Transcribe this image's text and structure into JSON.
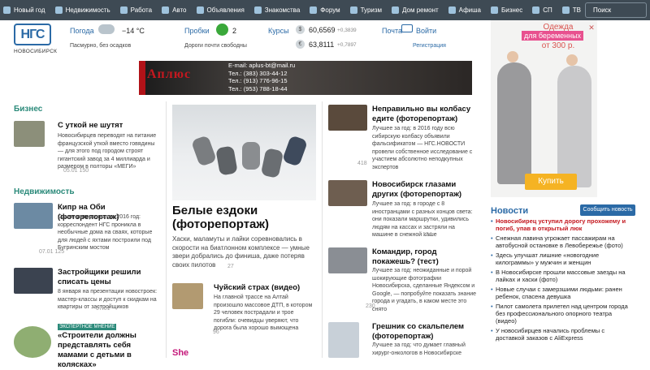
{
  "nav": {
    "items": [
      {
        "label": "Новый год",
        "icon": "snowflake-icon"
      },
      {
        "label": "Недвижимость",
        "icon": "house-icon"
      },
      {
        "label": "Работа",
        "icon": "briefcase-icon"
      },
      {
        "label": "Авто",
        "icon": "car-icon"
      },
      {
        "label": "Объявления",
        "icon": "megaphone-icon"
      },
      {
        "label": "Знакомства",
        "icon": "heart-icon"
      },
      {
        "label": "Форум",
        "icon": "chat-icon"
      },
      {
        "label": "Туризм",
        "icon": "plane-icon"
      },
      {
        "label": "Дом ремонт",
        "icon": "sofa-icon"
      },
      {
        "label": "Афиша",
        "icon": "ticket-icon"
      },
      {
        "label": "Бизнес",
        "icon": "chart-icon"
      },
      {
        "label": "СП",
        "icon": "cart-icon"
      },
      {
        "label": "ТВ",
        "icon": "tv-icon"
      }
    ],
    "search_label": "Поиск"
  },
  "brand": {
    "logo": "НГС",
    "city": "НОВОСИБИРСК"
  },
  "widgets": {
    "weather": {
      "label": "Погода",
      "temp": "−14 °C",
      "desc": "Пасмурно, без осадков"
    },
    "traffic": {
      "label": "Пробки",
      "score": "2",
      "desc": "Дороги почти свободны"
    },
    "rates": {
      "label": "Курсы",
      "usd": "60,6569",
      "usd_delta": "+0,3839",
      "eur": "63,8111",
      "eur_delta": "+0,7897"
    },
    "mail": {
      "label": "Почта",
      "login": "Войти",
      "register": "Регистрация"
    }
  },
  "banner": {
    "logo": "Аплюс",
    "lines": [
      "E-mail: aplus-bt@mail.ru",
      "Тел.: (383) 303-44-12",
      "Тел.: (913) 776-96-15",
      "Тел.: (953) 788-18-44"
    ]
  },
  "business": {
    "section": "Бизнес",
    "title": "С уткой не шутят",
    "text": "Новосибирцев переводят на питание французской уткой вместо говядины — для этого под городом строят гигантский завод за 4 миллиарда и размером в полторы «МЕГИ»",
    "meta": "05.01  150"
  },
  "realty": {
    "section": "Недвижимость",
    "items": [
      {
        "title": "Кипр на Оби (фоторепортаж)",
        "text": "Самое интересное за 2016 год: корреспондент НГС проникла в необычные дома на сваях, которые для людей с яхтами построили под Бугринским мостом",
        "meta": "07.01  125"
      },
      {
        "title": "Застройщики решили списать цены",
        "text": "8 января на презентации новостроек: мастер-классы и доступ к скидкам на квартиры от застройщиков",
        "meta": "07.01"
      }
    ]
  },
  "expert": {
    "badge": "ЭКСПЕРТНОЕ МНЕНИЕ",
    "title": "«Строители должны представлять себя мамами с детьми в колясках»"
  },
  "featured": {
    "title": "Белые ездоки (фоторепортаж)",
    "text": "Хаски, маламуты и лайки соревновались в скорости на биатлонном комплексе — умные звери добрались до финиша, даже потеряв своих пилотов",
    "meta": "27"
  },
  "chuy": {
    "title": "Чуйский страх (видео)",
    "text": "На главной трассе на Алтай произошло массовое ДТП, в котором 29 человек пострадали и трое погибли: очевидцы уверяют, что дорога была хорошо вымощена",
    "meta": "96"
  },
  "she": "She",
  "col3": [
    {
      "title": "Неправильно вы колбасу едите (фоторепортаж)",
      "text": "Лучшее за год: в 2016 году всю сибирскую колбасу объявили фальсификатом — НГС.НОВОСТИ провели собственное исследование с участием абсолютно неподкупных экспертов",
      "meta": "418"
    },
    {
      "title": "Новосибирск глазами других (фоторепортаж)",
      "text": "Лучшее за год: в городе с 8 иностранцами с разных концов света: они показали маршрутки, удивились людям на кассах и застряли на машине в снежной каше",
      "meta": "124"
    },
    {
      "title": "Командир, город покажешь? (тест)",
      "text": "Лучшее за год: неожиданные и порой шокирующие фотографии Новосибирска, сделанные Яндексом и Google, — попробуйте показать знание города и угадать, в каком месте это снято",
      "meta": "230"
    },
    {
      "title": "Грешник со скальпелем (фоторепортаж)",
      "text": "Лучшее за год: что думает главный хирург-онкологов в Новосибирске",
      "meta": ""
    }
  ],
  "ad": {
    "line1": "Одежда",
    "line2": "для беременных",
    "line3": "от 300 р.",
    "button": "Купить"
  },
  "news": {
    "title": "Новости",
    "report": "Сообщить новость",
    "items": [
      {
        "text": "Новосибирец уступил дорогу прохожему и погиб, упав в открытый люк",
        "hot": true
      },
      {
        "text": "Снежная лавина угрожает пассажирам на автобусной остановке в Левобережье (фото)",
        "hot": false
      },
      {
        "text": "Здесь улучшат лишние «новогодние килограммы» у мужчин и женщин",
        "hot": false
      },
      {
        "text": "В Новосибирске прошли массовые заезды на лайках и хаски (фото)",
        "hot": false
      },
      {
        "text": "Новые случаи с замерзшими людьми: ранен ребенок, спасена девушка",
        "hot": false
      },
      {
        "text": "Пилот самолета прилетел над центром города без профессионального опорного театра (видео)",
        "hot": false
      },
      {
        "text": "У новосибирцев начались проблемы с доставкой заказов с AliExpress",
        "hot": false
      }
    ]
  }
}
